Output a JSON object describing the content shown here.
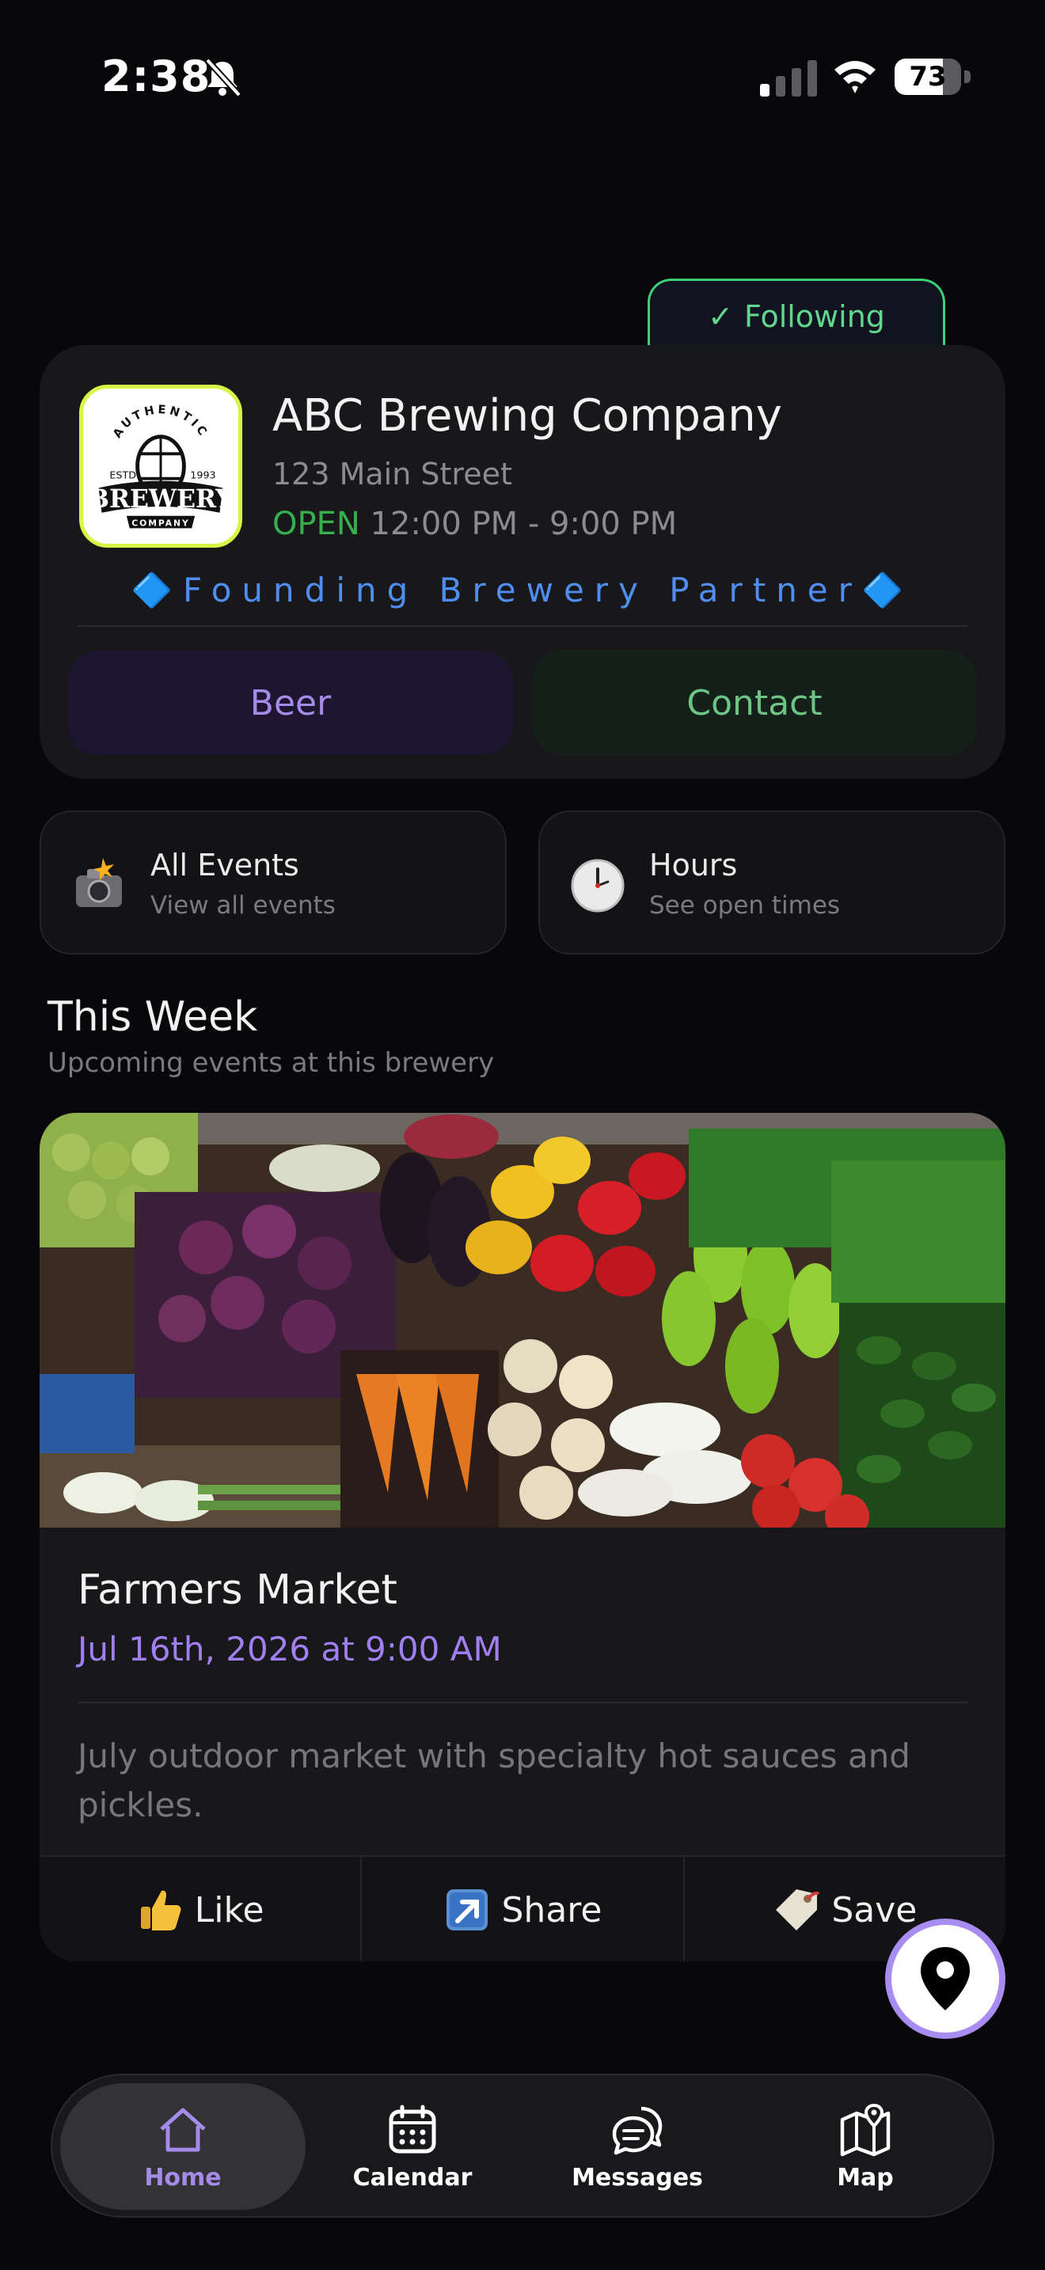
{
  "status_bar": {
    "time": "2:38",
    "battery": "73",
    "battery_fraction": 0.73
  },
  "brewery": {
    "follow_label": "Following",
    "follow_check": "✓",
    "name": "ABC Brewing Company",
    "address": "123 Main Street",
    "open_status": "OPEN",
    "hours": "12:00 PM - 9:00 PM",
    "partner_badge": "🔷Founding Brewery Partner🔷",
    "logo_top": "AUTHENTIC",
    "logo_main": "BREWERY",
    "logo_sub": "COMPANY",
    "logo_estd": "ESTD",
    "logo_year": "1993",
    "beer_button": "Beer",
    "contact_button": "Contact"
  },
  "quick_links": [
    {
      "title": "All Events",
      "subtitle": "View all events",
      "icon": "camera-flash-icon"
    },
    {
      "title": "Hours",
      "subtitle": "See open times",
      "icon": "clock-icon"
    }
  ],
  "section": {
    "title": "This Week",
    "subtitle": "Upcoming events at this brewery"
  },
  "event": {
    "title": "Farmers Market",
    "date": "Jul 16th, 2026 at 9:00 AM",
    "description": "July outdoor market with specialty hot sauces and pickles.",
    "actions": {
      "like": "Like",
      "share": "Share",
      "save": "Save"
    }
  },
  "tabbar": {
    "home": "Home",
    "calendar": "Calendar",
    "messages": "Messages",
    "map": "Map",
    "active": "Home",
    "active_color": "#a58be8"
  },
  "colors": {
    "open": "#36b04c",
    "partner": "#4f8ef0",
    "accent": "#a98cf0",
    "following": "#3ecf7a"
  }
}
